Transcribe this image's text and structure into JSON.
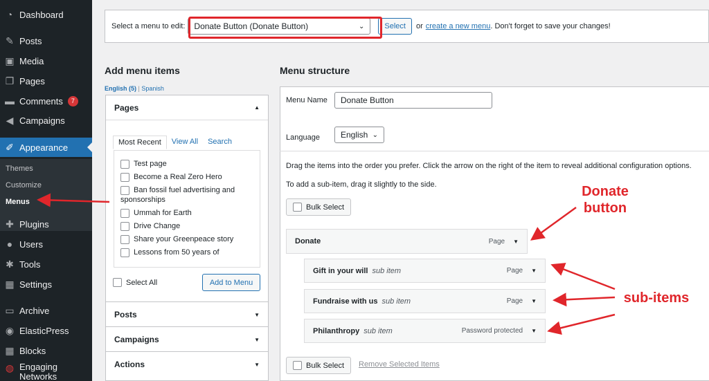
{
  "sidebar": {
    "items": [
      {
        "label": "Dashboard",
        "icon": "dashboard-icon",
        "glyph": "◔"
      },
      {
        "label": "Posts",
        "icon": "pushpin-icon",
        "glyph": "✎"
      },
      {
        "label": "Media",
        "icon": "media-icon",
        "glyph": "▣"
      },
      {
        "label": "Pages",
        "icon": "page-icon",
        "glyph": "❐"
      },
      {
        "label": "Comments",
        "icon": "comment-icon",
        "glyph": "▬"
      },
      {
        "label": "Campaigns",
        "icon": "megaphone-icon",
        "glyph": "◀"
      },
      {
        "label": "Appearance",
        "icon": "paintbrush-icon",
        "glyph": "✐"
      },
      {
        "label": "Plugins",
        "icon": "plugin-icon",
        "glyph": "✚"
      },
      {
        "label": "Users",
        "icon": "user-icon",
        "glyph": "●"
      },
      {
        "label": "Tools",
        "icon": "wrench-icon",
        "glyph": "✱"
      },
      {
        "label": "Settings",
        "icon": "settings-icon",
        "glyph": "▦"
      },
      {
        "label": "Archive",
        "icon": "archive-icon",
        "glyph": "▭"
      },
      {
        "label": "ElasticPress",
        "icon": "elasticpress-icon",
        "glyph": "◉"
      },
      {
        "label": "Blocks",
        "icon": "blocks-icon",
        "glyph": "▦"
      },
      {
        "label": "Engaging Networks",
        "icon": "engaging-networks-icon",
        "glyph": "◍"
      }
    ],
    "comments_badge": "7",
    "submenu": [
      "Themes",
      "Customize",
      "Menus"
    ]
  },
  "topbar": {
    "select_label": "Select a menu to edit:",
    "selected_menu": "Donate Button (Donate Button)",
    "select_button": "Select",
    "or_text": "or",
    "create_link": "create a new menu",
    "after_text": ". Don't forget to save your changes!"
  },
  "add_items": {
    "title": "Add menu items",
    "lang_english": "English (5)",
    "lang_sep": "|",
    "lang_spanish": "Spanish",
    "pages_title": "Pages",
    "tabs": [
      "Most Recent",
      "View All",
      "Search"
    ],
    "pages": [
      "Test page",
      "Become a Real Zero Hero",
      "Ban fossil fuel advertising and",
      "sponsorships",
      "Ummah for Earth",
      "Drive Change",
      "Share your Greenpeace story",
      "Lessons from 50 years of"
    ],
    "select_all": "Select All",
    "add_button": "Add to Menu",
    "sections": [
      "Posts",
      "Campaigns",
      "Actions"
    ]
  },
  "structure": {
    "title": "Menu structure",
    "name_label": "Menu Name",
    "name_value": "Donate Button",
    "language_label": "Language",
    "language_value": "English",
    "instructions": "Drag the items into the order you prefer. Click the arrow on the right of the item to reveal additional configuration options.",
    "subitem_hint": "To add a sub-item, drag it slightly to the side.",
    "bulk_select": "Bulk Select",
    "remove_selected": "Remove Selected Items",
    "items": [
      {
        "title": "Donate",
        "sub": "",
        "type": "Page"
      },
      {
        "title": "Gift in your will",
        "sub": "sub item",
        "type": "Page"
      },
      {
        "title": "Fundraise with us",
        "sub": "sub item",
        "type": "Page"
      },
      {
        "title": "Philanthropy",
        "sub": "sub item",
        "type": "Password protected"
      }
    ]
  },
  "annotations": {
    "donate_line1": "Donate",
    "donate_line2": "button",
    "subitems": "sub-items",
    "color": "#e0262b"
  },
  "colors": {
    "accent": "#2271b1",
    "sidebar": "#1d2327",
    "annotation": "#e0262b"
  }
}
